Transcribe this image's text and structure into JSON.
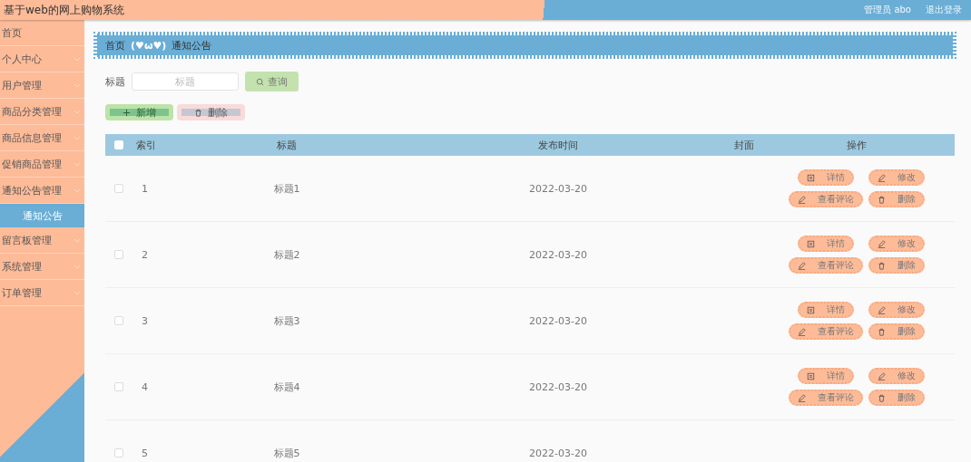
{
  "header": {
    "title": "基于web的网上购物系统",
    "user": "管理员 abo",
    "logout": "退出登录"
  },
  "sidebar": {
    "items": [
      {
        "label": "首页",
        "expandable": false
      },
      {
        "label": "个人中心",
        "expandable": true
      },
      {
        "label": "用户管理",
        "expandable": true
      },
      {
        "label": "商品分类管理",
        "expandable": true
      },
      {
        "label": "商品信息管理",
        "expandable": true
      },
      {
        "label": "促销商品管理",
        "expandable": true
      },
      {
        "label": "通知公告管理",
        "expandable": true,
        "children": [
          {
            "label": "通知公告",
            "selected": true
          }
        ]
      },
      {
        "label": "留言板管理",
        "expandable": true
      },
      {
        "label": "系统管理",
        "expandable": true
      },
      {
        "label": "订单管理",
        "expandable": true
      }
    ]
  },
  "breadcrumb": {
    "items": [
      "首页",
      "通知公告"
    ],
    "separator": "(♥ω♥)"
  },
  "search": {
    "label": "标题",
    "placeholder": "标题",
    "button": "查询"
  },
  "toolbar": [
    {
      "kind": "add",
      "label": "新增"
    },
    {
      "kind": "delete",
      "label": "删除"
    }
  ],
  "table": {
    "all_checked": false,
    "columns": [
      "索引",
      "标题",
      "发布时间",
      "封面",
      "操作"
    ],
    "rows": [
      {
        "checked": false,
        "index": "1",
        "title": "标题1",
        "date": "2022-03-20",
        "actions": [
          {
            "kind": "detail",
            "label": "详情"
          },
          {
            "kind": "edit",
            "label": "修改"
          },
          {
            "kind": "comment",
            "label": "查看评论"
          },
          {
            "kind": "delete",
            "label": "删除"
          }
        ]
      },
      {
        "checked": false,
        "index": "2",
        "title": "标题2",
        "date": "2022-03-20",
        "actions": [
          {
            "kind": "detail",
            "label": "详情"
          },
          {
            "kind": "edit",
            "label": "修改"
          },
          {
            "kind": "comment",
            "label": "查看评论"
          },
          {
            "kind": "delete",
            "label": "删除"
          }
        ]
      },
      {
        "checked": false,
        "index": "3",
        "title": "标题3",
        "date": "2022-03-20",
        "actions": [
          {
            "kind": "detail",
            "label": "详情"
          },
          {
            "kind": "edit",
            "label": "修改"
          },
          {
            "kind": "comment",
            "label": "查看评论"
          },
          {
            "kind": "delete",
            "label": "删除"
          }
        ]
      },
      {
        "checked": false,
        "index": "4",
        "title": "标题4",
        "date": "2022-03-20",
        "actions": [
          {
            "kind": "detail",
            "label": "详情"
          },
          {
            "kind": "edit",
            "label": "修改"
          },
          {
            "kind": "comment",
            "label": "查看评论"
          },
          {
            "kind": "delete",
            "label": "删除"
          }
        ]
      },
      {
        "checked": false,
        "index": "5",
        "title": "标题5",
        "date": "2022-03-20",
        "actions": []
      }
    ]
  }
}
